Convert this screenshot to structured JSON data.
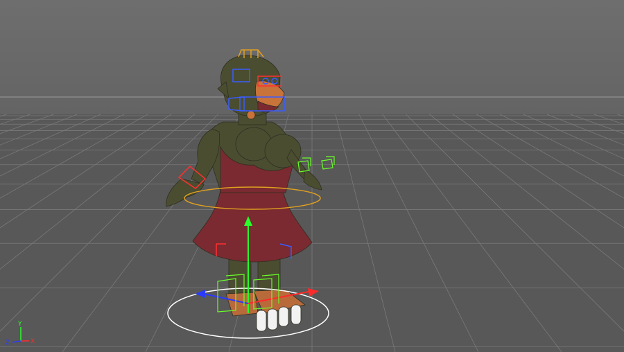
{
  "viewport": {
    "name": "3d-viewport",
    "colors": {
      "sky_top": "#6e6e6e",
      "sky_bottom": "#646464",
      "floor": "#585858",
      "grid": "#7a7a7a",
      "horizon": "#9a9a9a"
    }
  },
  "character": {
    "colors": {
      "body": "#4a4d30",
      "dress": "#7a2a30",
      "beak": "#c8733a",
      "feet": "#b86a3a",
      "claws": "#f2f2f2"
    }
  },
  "rig_controls": {
    "colors": {
      "fk": "#3a5cff",
      "ik": "#ff3030",
      "joint": "#6aff2a",
      "hip": "#e0a020",
      "root": "#ffffff",
      "axis_x": "#ff2a2a",
      "axis_y": "#2aff2a",
      "axis_z": "#2a3aff"
    }
  },
  "axis_gizmo": {
    "x_label": "X",
    "y_label": "Y",
    "z_label": "Z"
  }
}
